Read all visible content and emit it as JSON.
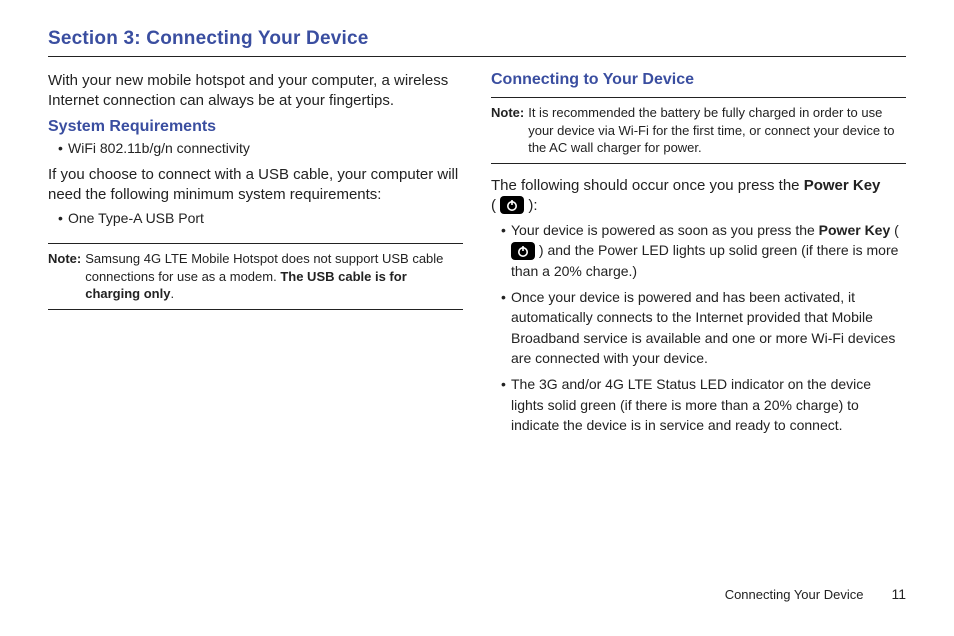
{
  "section_title": "Section 3: Connecting Your Device",
  "left": {
    "intro": "With your new mobile hotspot and your computer, a wireless Internet connection can always be at your fingertips.",
    "subhead": "System Requirements",
    "bullet1": "WiFi 802.11b/g/n connectivity",
    "usb_intro": "If you choose to connect with a USB cable, your computer will need the following minimum system requirements:",
    "bullet2": "One Type-A USB Port",
    "note_label": "Note:",
    "note_text_1": "Samsung 4G LTE Mobile Hotspot does not support USB cable connections for use as a modem. ",
    "note_text_bold": "The USB cable is for charging only",
    "note_text_2": "."
  },
  "right": {
    "subhead": "Connecting to Your Device",
    "note_label": "Note:",
    "note_text": "It is recommended the battery be fully charged in order to use your device via Wi-Fi for the first time, or connect your device to the AC wall charger for power.",
    "following_1": "The following should occur once you press the ",
    "following_bold": "Power Key",
    "following_2a": "( ",
    "following_2b": " ):",
    "b1_a": "Your device is powered as soon as you press the ",
    "b1_bold": "Power Key",
    "b1_b": " ( ",
    "b1_c": " ) and the Power LED lights up solid green (if there is more than a 20% charge.)",
    "b2": "Once your device is powered and has been activated, it automatically connects to the Internet provided that Mobile Broadband service is available and one or more Wi-Fi devices are connected with your device.",
    "b3": "The 3G and/or 4G LTE Status LED indicator on the device lights solid green (if there is more than a 20% charge) to indicate the device is in service and ready to connect."
  },
  "footer": {
    "label": "Connecting Your Device",
    "page": "11"
  }
}
